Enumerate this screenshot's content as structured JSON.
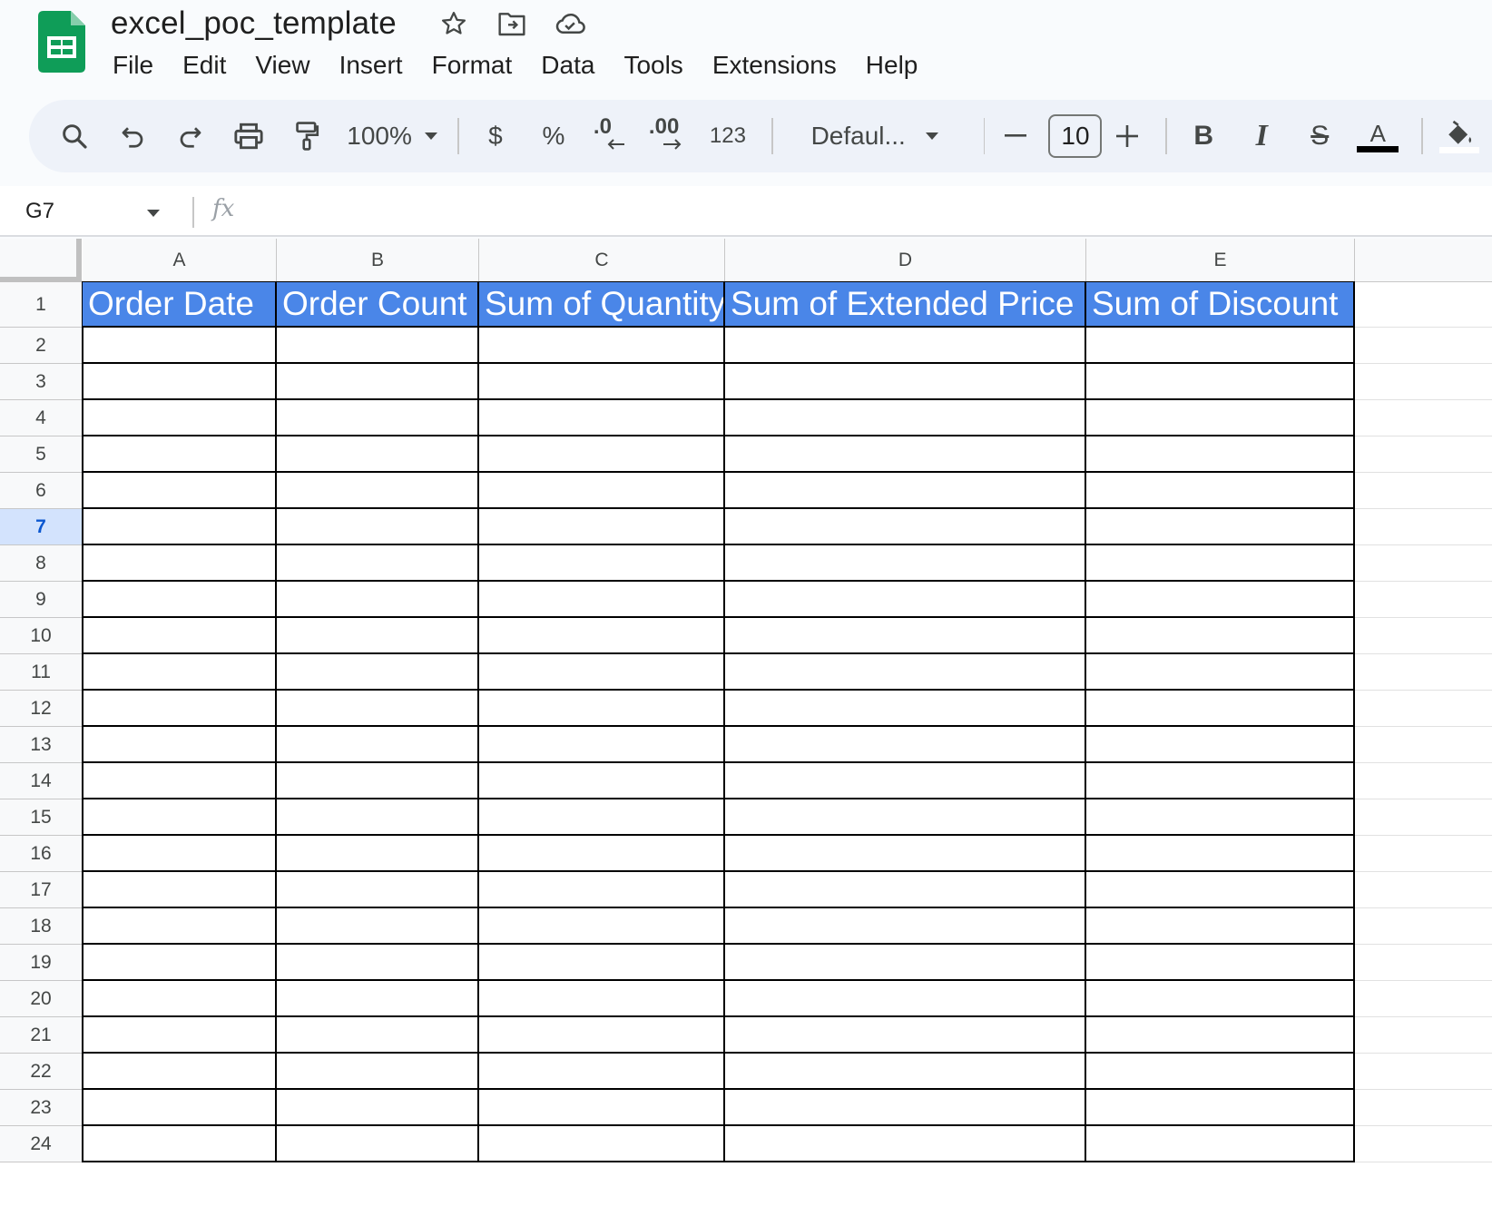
{
  "app": {
    "doc_title": "excel_poc_template",
    "brand_color": "#0f9d58"
  },
  "menu": [
    "File",
    "Edit",
    "View",
    "Insert",
    "Format",
    "Data",
    "Tools",
    "Extensions",
    "Help"
  ],
  "toolbar": {
    "zoom": "100%",
    "currency_label": "$",
    "percent_label": "%",
    "decrease_decimal_label": ".0",
    "increase_decimal_label": ".00",
    "number_format_label": "123",
    "font_name": "Defaul...",
    "font_size": "10",
    "bold_label": "B",
    "italic_label": "I",
    "strike_label": "S",
    "text_color_label": "A",
    "text_color": "#000000"
  },
  "formula_bar": {
    "name_box": "G7",
    "fx_label": "fx",
    "formula": ""
  },
  "sheet": {
    "columns": [
      "A",
      "B",
      "C",
      "D",
      "E"
    ],
    "rows": [
      "1",
      "2",
      "3",
      "4",
      "5",
      "6",
      "7",
      "8",
      "9",
      "10",
      "11",
      "12",
      "13",
      "14",
      "15",
      "16",
      "17",
      "18",
      "19",
      "20",
      "21",
      "22",
      "23",
      "24"
    ],
    "selected_row": "7",
    "header_fill": "#4a86e8",
    "header_row": [
      "Order Date",
      "Order Count",
      "Sum of Quantity",
      "Sum of Extended Price",
      "Sum of Discount"
    ]
  }
}
